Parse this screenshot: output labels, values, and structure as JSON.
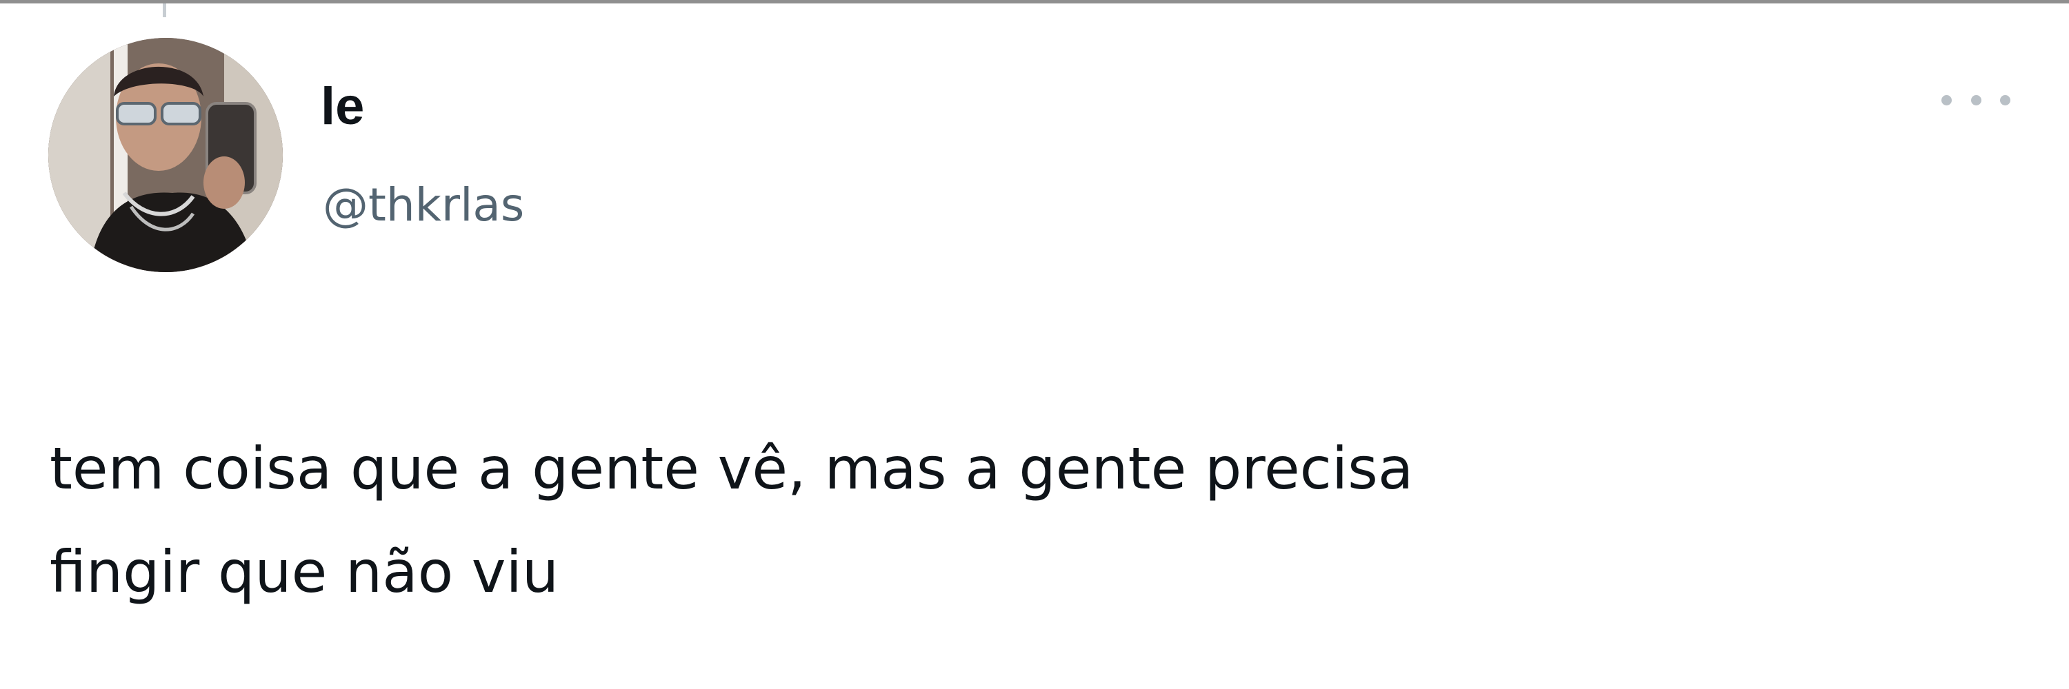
{
  "tweet": {
    "author": {
      "display_name": "le",
      "handle": "@thkrlas",
      "avatar_icon": "profile-photo"
    },
    "more_icon": "more-horizontal-icon",
    "text": "tem coisa que a gente vê, mas a gente precisa\nfingir que não viu"
  },
  "colors": {
    "text_primary": "#0f1419",
    "text_secondary": "#536471",
    "icon_muted": "#b9c0c6"
  }
}
